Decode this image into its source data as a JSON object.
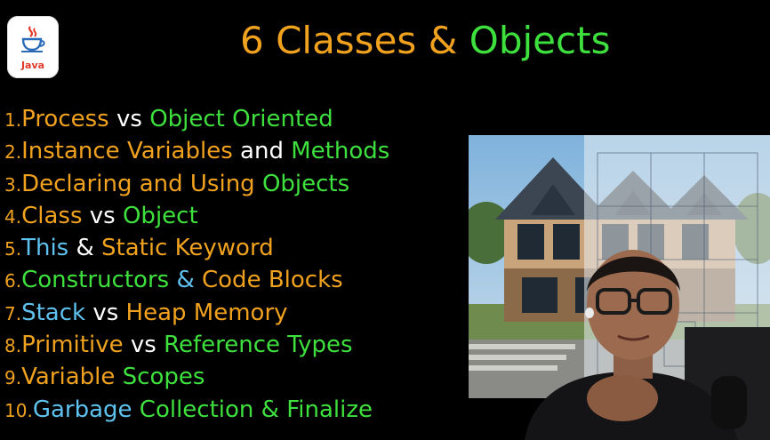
{
  "logo": {
    "text": "Java"
  },
  "title": {
    "part1": "6 Classes",
    "part2": "&",
    "part3": "Objects"
  },
  "topics": [
    {
      "num": "1.",
      "segments": [
        {
          "text": "Process",
          "color": "orange"
        },
        {
          "text": " vs ",
          "color": "white"
        },
        {
          "text": "Object Oriented",
          "color": "green"
        }
      ]
    },
    {
      "num": "2.",
      "segments": [
        {
          "text": "Instance Variables",
          "color": "orange"
        },
        {
          "text": " and ",
          "color": "white"
        },
        {
          "text": "Methods",
          "color": "green"
        }
      ]
    },
    {
      "num": "3.",
      "segments": [
        {
          "text": "Declaring and Using",
          "color": "orange"
        },
        {
          "text": " Objects",
          "color": "green"
        }
      ]
    },
    {
      "num": "4.",
      "segments": [
        {
          "text": "Class",
          "color": "orange"
        },
        {
          "text": " vs ",
          "color": "white"
        },
        {
          "text": "Object",
          "color": "green"
        }
      ]
    },
    {
      "num": "5.",
      "segments": [
        {
          "text": "This",
          "color": "blue"
        },
        {
          "text": " & ",
          "color": "white"
        },
        {
          "text": "Static Keyword",
          "color": "orange"
        }
      ]
    },
    {
      "num": "6.",
      "segments": [
        {
          "text": "Constructors",
          "color": "green"
        },
        {
          "text": " & ",
          "color": "blue"
        },
        {
          "text": "Code Blocks",
          "color": "orange"
        }
      ]
    },
    {
      "num": "7.",
      "segments": [
        {
          "text": "Stack",
          "color": "blue"
        },
        {
          "text": " vs ",
          "color": "white"
        },
        {
          "text": "Heap Memory",
          "color": "orange"
        }
      ]
    },
    {
      "num": "8.",
      "segments": [
        {
          "text": "Primitive",
          "color": "orange"
        },
        {
          "text": " vs ",
          "color": "white"
        },
        {
          "text": "Reference Types",
          "color": "green"
        }
      ]
    },
    {
      "num": "9.",
      "segments": [
        {
          "text": "Variable",
          "color": "orange"
        },
        {
          "text": " Scopes",
          "color": "green"
        }
      ]
    },
    {
      "num": "10.",
      "segments": [
        {
          "text": "Garbage",
          "color": "blue"
        },
        {
          "text": " Collection & Finalize",
          "color": "green"
        }
      ]
    }
  ],
  "colors": {
    "orange": "#f0a21f",
    "green": "#3ee03e",
    "blue": "#5fc2ee",
    "white": "#ffffff"
  }
}
